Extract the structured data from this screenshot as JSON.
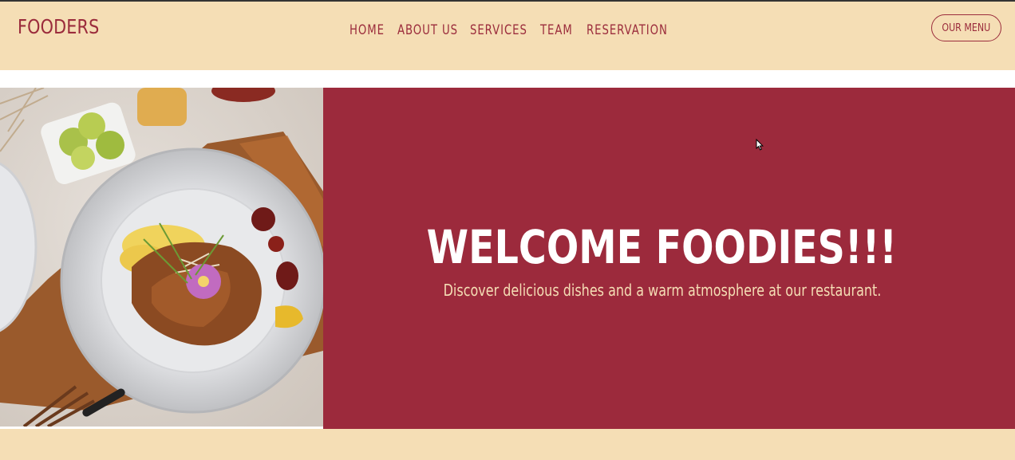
{
  "header": {
    "brand": "FOODERS",
    "nav": [
      {
        "label": "HOME"
      },
      {
        "label": "ABOUT US"
      },
      {
        "label": "SERVICES"
      },
      {
        "label": "TEAM"
      },
      {
        "label": "RESERVATION"
      }
    ],
    "menu_button": "OUR MENU"
  },
  "hero": {
    "title": "WELCOME FOODIES!!!",
    "subtitle": "Discover delicious dishes and a warm atmosphere at our restaurant.",
    "image_subject": "plated-food-photo"
  },
  "colors": {
    "cream": "#f5deb5",
    "burgundy": "#9c2a3c",
    "white": "#ffffff"
  },
  "icons": [
    "mouse-cursor-icon"
  ]
}
